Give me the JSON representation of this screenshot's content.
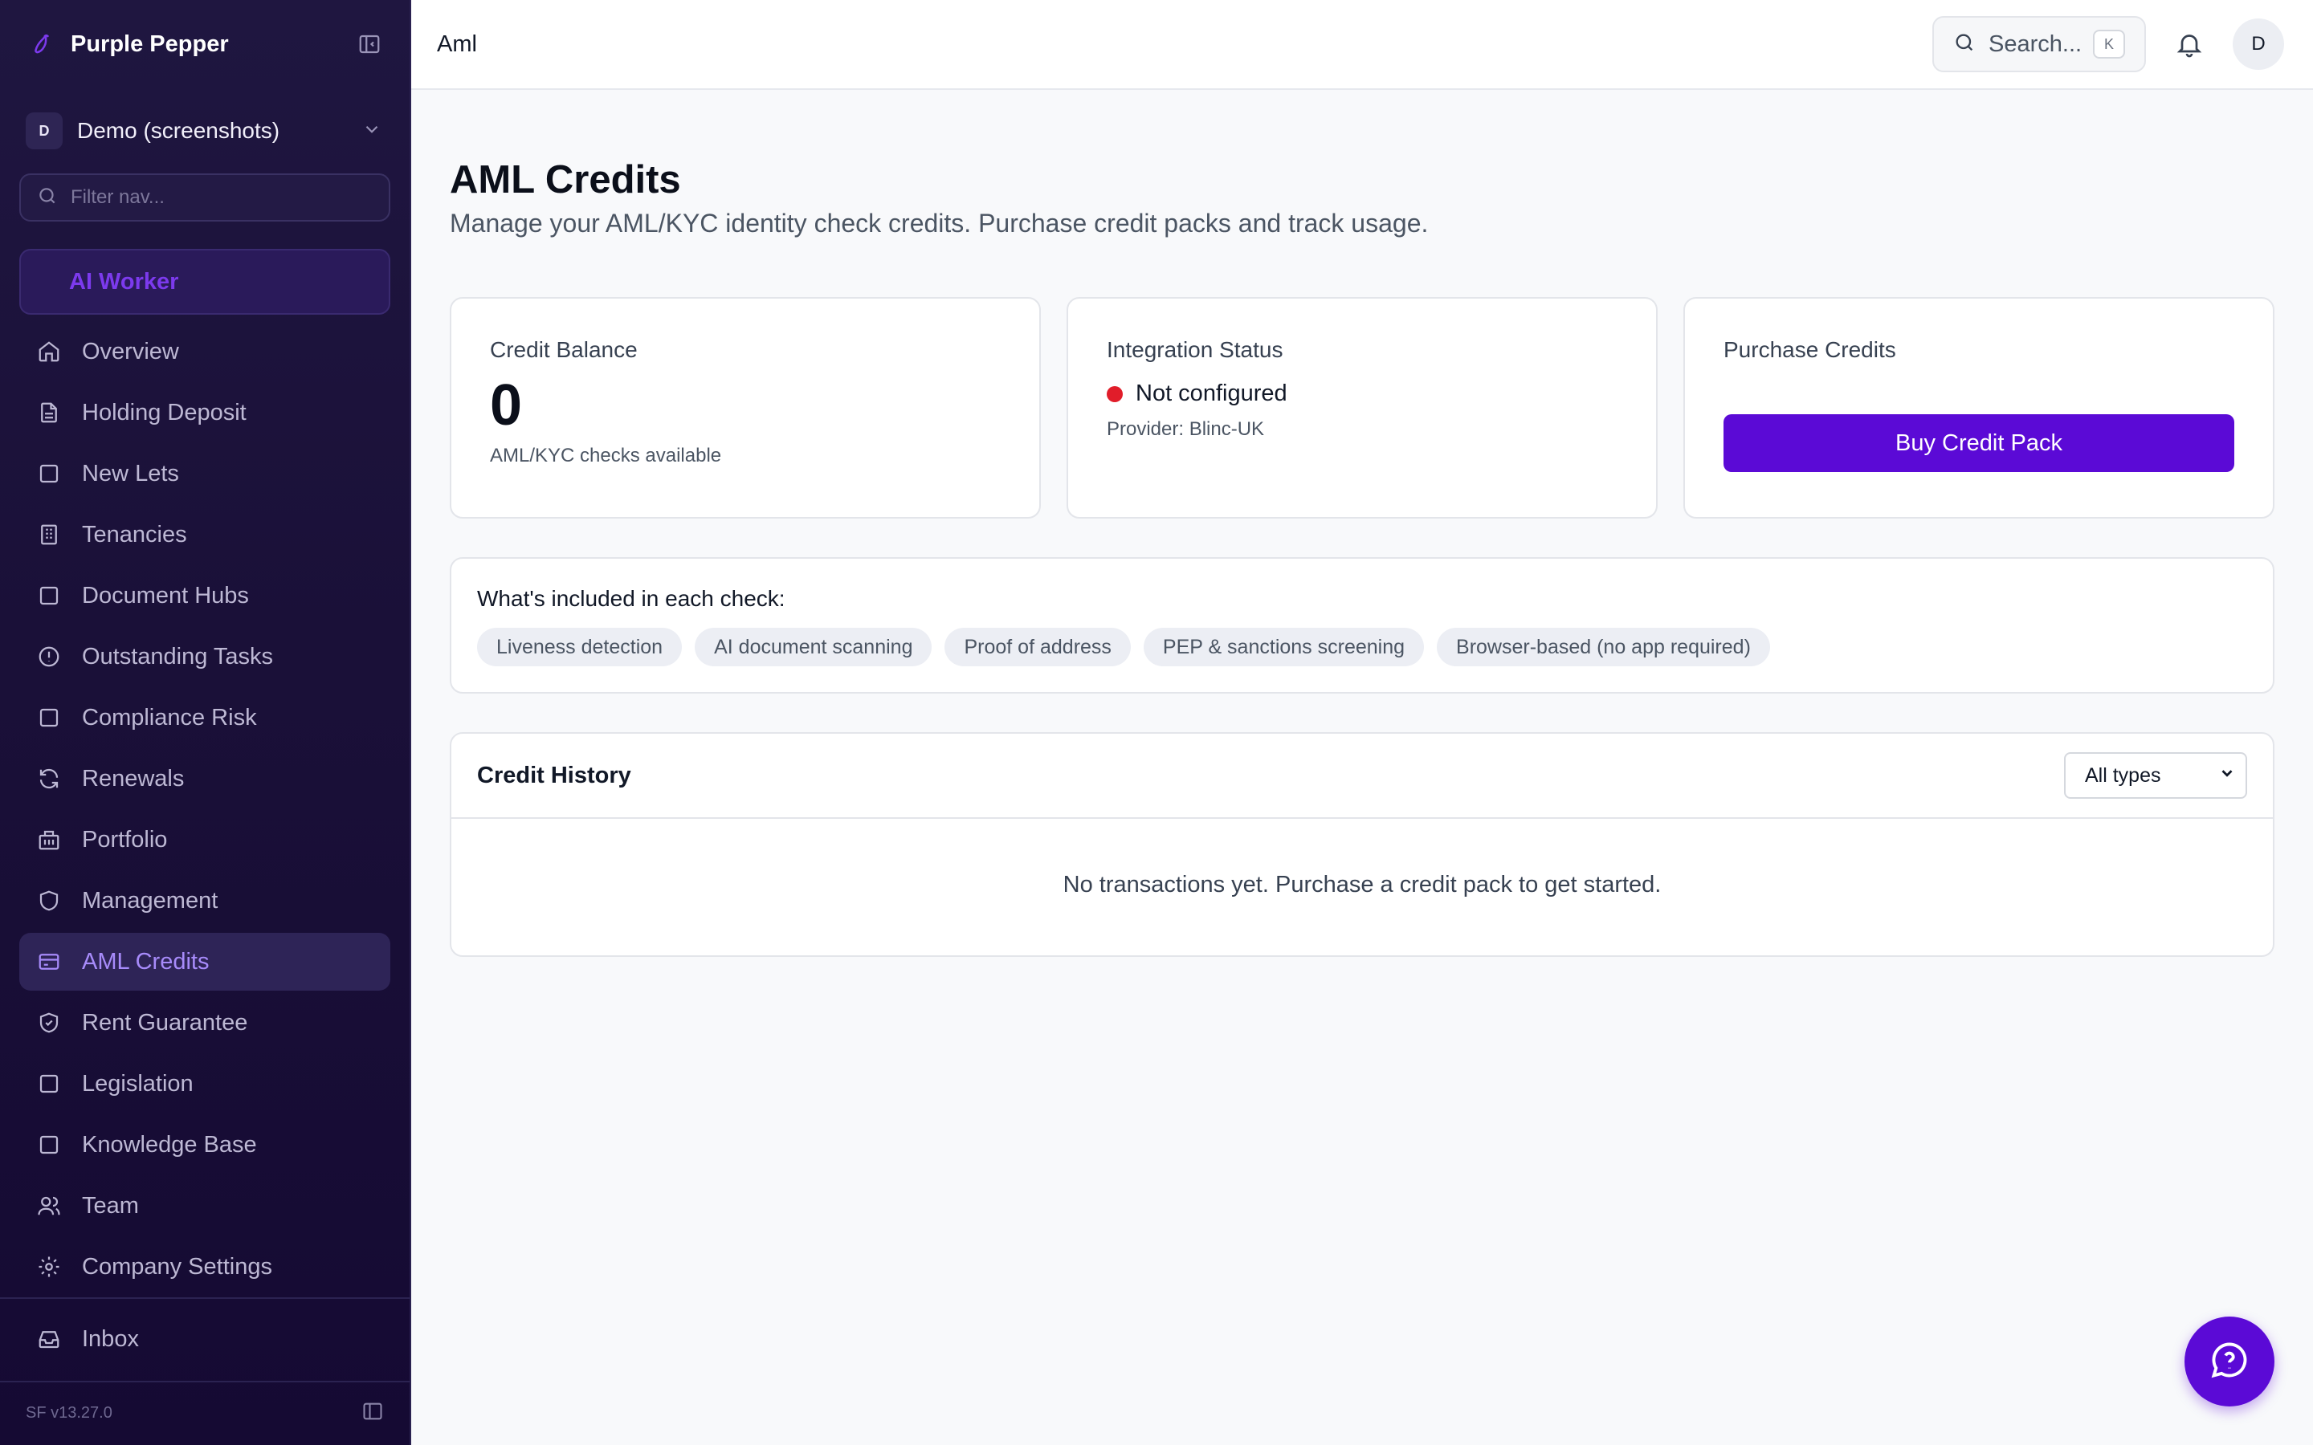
{
  "sidebar": {
    "brand": "Purple Pepper",
    "workspace": {
      "initial": "D",
      "name": "Demo (screenshots)"
    },
    "filter_placeholder": "Filter nav...",
    "ai_worker": "AI Worker",
    "items": [
      {
        "label": "Overview",
        "icon": "home-icon"
      },
      {
        "label": "Holding Deposit",
        "icon": "file-text-icon"
      },
      {
        "label": "New Lets",
        "icon": "square-icon"
      },
      {
        "label": "Tenancies",
        "icon": "building-icon"
      },
      {
        "label": "Document Hubs",
        "icon": "square-icon"
      },
      {
        "label": "Outstanding Tasks",
        "icon": "alert-circle-icon"
      },
      {
        "label": "Compliance Risk",
        "icon": "square-icon"
      },
      {
        "label": "Renewals",
        "icon": "refresh-icon"
      },
      {
        "label": "Portfolio",
        "icon": "buildings-icon"
      },
      {
        "label": "Management",
        "icon": "shield-icon"
      },
      {
        "label": "AML Credits",
        "icon": "credit-card-icon",
        "active": true
      },
      {
        "label": "Rent Guarantee",
        "icon": "shield-check-icon"
      },
      {
        "label": "Legislation",
        "icon": "square-icon"
      },
      {
        "label": "Knowledge Base",
        "icon": "square-icon"
      },
      {
        "label": "Team",
        "icon": "users-icon"
      },
      {
        "label": "Company Settings",
        "icon": "gear-icon"
      }
    ],
    "inbox": "Inbox",
    "version": "SF v13.27.0"
  },
  "topbar": {
    "breadcrumb": "Aml",
    "search_placeholder": "Search...",
    "search_shortcut": "K",
    "avatar_initial": "D"
  },
  "page": {
    "title": "AML Credits",
    "subtitle": "Manage your AML/KYC identity check credits. Purchase credit packs and track usage."
  },
  "cards": {
    "balance": {
      "label": "Credit Balance",
      "value": "0",
      "sub": "AML/KYC checks available"
    },
    "integration": {
      "label": "Integration Status",
      "status": "Not configured",
      "provider": "Provider: Blinc-UK",
      "status_color": "#e11d2a"
    },
    "purchase": {
      "label": "Purchase Credits",
      "button": "Buy Credit Pack"
    }
  },
  "included": {
    "title": "What's included in each check:",
    "chips": [
      "Liveness detection",
      "AI document scanning",
      "Proof of address",
      "PEP & sanctions screening",
      "Browser-based (no app required)"
    ]
  },
  "history": {
    "title": "Credit History",
    "filter_value": "All types",
    "empty_message": "No transactions yet. Purchase a credit pack to get started."
  },
  "colors": {
    "accent": "#5b0ad6",
    "sidebar_bg": "#1a1038",
    "active_nav": "#a78bfa"
  }
}
